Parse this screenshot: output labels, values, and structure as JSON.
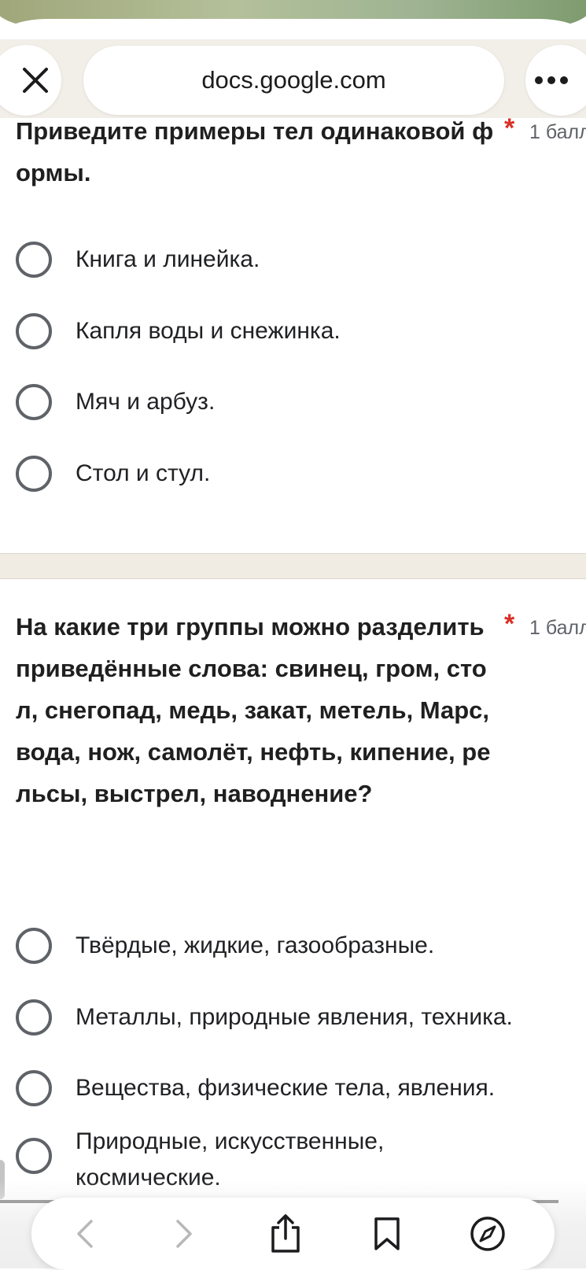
{
  "browser": {
    "url": "docs.google.com",
    "close_icon": "close-icon",
    "more_icon": "more-horizontal-icon"
  },
  "questions": [
    {
      "title": "Приведите примеры тел одинаковой формы.",
      "required_mark": "*",
      "points": "1 балл",
      "options": [
        "Книга и линейка.",
        "Капля воды и снежинка.",
        "Мяч и арбуз.",
        "Стол и стул."
      ]
    },
    {
      "title": "На какие три группы можно разделить приведённые слова: свинец, гром, стол, снегопад, медь, закат, метель, Марс, вода, нож, самолёт, нефть, кипение, рельсы, выстрел, наводнение?",
      "required_mark": "*",
      "points": "1 балл",
      "options": [
        "Твёрдые, жидкие, газообразные.",
        "Металлы, природные явления, техника.",
        "Вещества, физические тела, явления.",
        "Природные, искусственные, космические."
      ]
    }
  ],
  "toolbar": {
    "icons": [
      "back-icon",
      "forward-icon",
      "share-icon",
      "bookmark-icon",
      "compass-icon"
    ]
  },
  "colors": {
    "required": "#d93025",
    "radio_border": "#5f6368",
    "separator": "#f0ebe3"
  }
}
